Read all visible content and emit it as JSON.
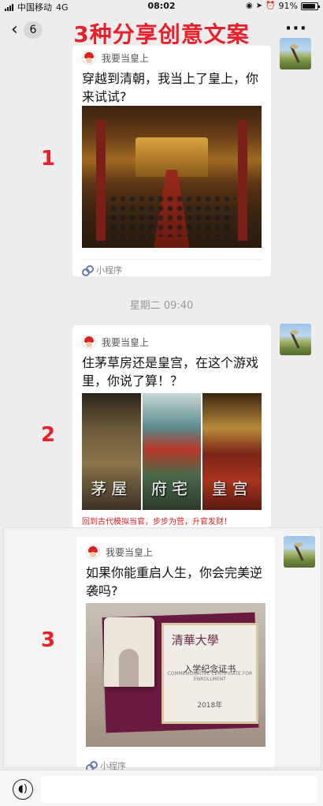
{
  "status_bar": {
    "carrier": "中国移动",
    "network": "4G",
    "time": "08:02",
    "battery_percent": "91%"
  },
  "nav": {
    "back_count": "6",
    "title": "3种分享创意文案",
    "more_label": "···"
  },
  "messages": [
    {
      "step": "1",
      "app_name": "我要当皇上",
      "title": "穿越到清朝，我当上了皇上，你来试试?",
      "footer": "小程序"
    },
    {
      "step": "2",
      "app_name": "我要当皇上",
      "title": "住茅草房还是皇宫，在这个游戏里，你说了算！？",
      "panels": [
        "茅屋",
        "府宅",
        "皇宫"
      ],
      "caption": "回到古代模拟当官，步步为营，升官发财！"
    },
    {
      "step": "3",
      "app_name": "我要当皇上",
      "title": "如果你能重启人生，你会完美逆袭吗?",
      "footer": "小程序",
      "certificate": {
        "university": "清華大學",
        "heading": "入学纪念证书",
        "subheading": "COMMEMORATIVE CERTIFICATE FOR ENROLLMENT",
        "year": "2018年"
      }
    }
  ],
  "timestamp": "星期二 09:40",
  "input_bar": {
    "voice_icon": "voice-icon"
  }
}
